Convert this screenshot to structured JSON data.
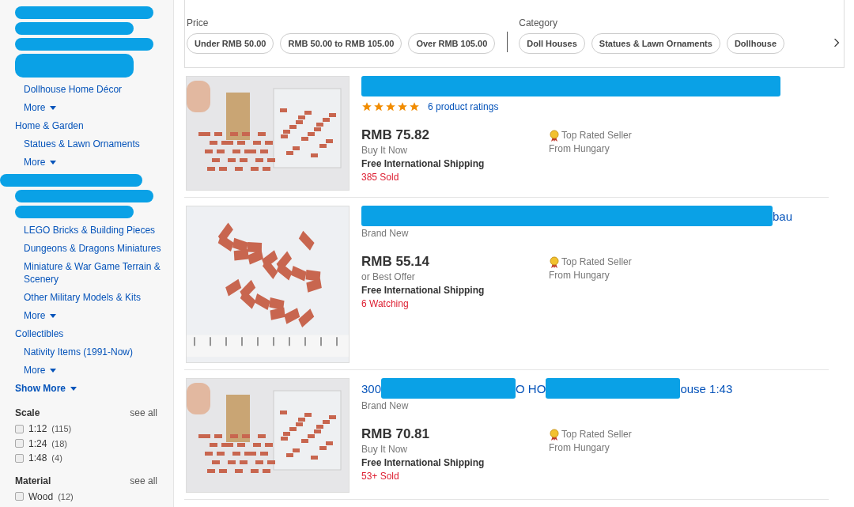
{
  "sidebar": {
    "groups": [
      {
        "children": [
          {
            "redacted": true
          },
          {
            "redacted": true
          },
          {
            "redacted": true
          },
          {
            "redacted": true,
            "tall": true
          },
          {
            "label": "Dollhouse Home Décor"
          }
        ],
        "more": "More"
      },
      {
        "label": "Home & Garden",
        "children": [
          {
            "label": "Statues & Lawn Ornaments"
          }
        ],
        "more": "More"
      },
      {
        "redacted": true,
        "children": [
          {
            "redacted": true
          },
          {
            "redacted": true
          },
          {
            "label": "LEGO Bricks & Building Pieces"
          },
          {
            "label": "Dungeons & Dragons Miniatures"
          },
          {
            "label": "Miniature & War Game Terrain & Scenery"
          },
          {
            "label": "Other Military Models & Kits"
          }
        ],
        "more": "More"
      },
      {
        "label": "Collectibles",
        "children": [
          {
            "label": "Nativity Items (1991-Now)"
          }
        ],
        "more": "More"
      }
    ],
    "show_more": "Show More",
    "facets": [
      {
        "title": "Scale",
        "see_all": "see all",
        "options": [
          {
            "label": "1:12",
            "count": "(115)",
            "checked": false
          },
          {
            "label": "1:24",
            "count": "(18)",
            "checked": false
          },
          {
            "label": "1:48",
            "count": "(4)",
            "checked": false
          }
        ]
      },
      {
        "title": "Material",
        "see_all": "see all",
        "options": [
          {
            "label": "Wood",
            "count": "(12)",
            "checked": false
          }
        ]
      }
    ]
  },
  "filters": [
    {
      "title": "Price",
      "chips": [
        "Under RMB 50.00",
        "RMB 50.00 to RMB 105.00",
        "Over RMB 105.00"
      ]
    },
    {
      "title": "Category",
      "chips": [
        "Doll Houses",
        "Statues & Lawn Ornaments",
        "Dollhouse"
      ]
    }
  ],
  "listings": [
    {
      "title": [
        {
          "kind": "redacted"
        }
      ],
      "stars": 5,
      "ratings": "6 product ratings",
      "price": "RMB 75.82",
      "format": "Buy It Now",
      "shipping": "Free International Shipping",
      "activity": "385 Sold",
      "seller": "Top Rated Seller",
      "location": "From Hungary",
      "photo": {
        "kind": "box"
      }
    },
    {
      "title": [
        {
          "kind": "redacted"
        },
        {
          "kind": "text",
          "text": "bau"
        }
      ],
      "condition": "Brand New",
      "price": "RMB 55.14",
      "format": "or Best Offer",
      "shipping": "Free International Shipping",
      "activity": "6 Watching",
      "seller": "Top Rated Seller",
      "location": "From Hungary",
      "photo": {
        "kind": "ruler"
      }
    },
    {
      "title": [
        {
          "kind": "text",
          "text": "300"
        },
        {
          "kind": "redacted"
        },
        {
          "kind": "text",
          "text": "O HO"
        },
        {
          "kind": "redacted"
        },
        {
          "kind": "text",
          "text": "ouse 1:43"
        }
      ],
      "condition": "Brand New",
      "price": "RMB 70.81",
      "format": "Buy It Now",
      "shipping": "Free International Shipping",
      "activity": "53+ Sold",
      "seller": "Top Rated Seller",
      "location": "From Hungary",
      "photo": {
        "kind": "box"
      }
    }
  ]
}
